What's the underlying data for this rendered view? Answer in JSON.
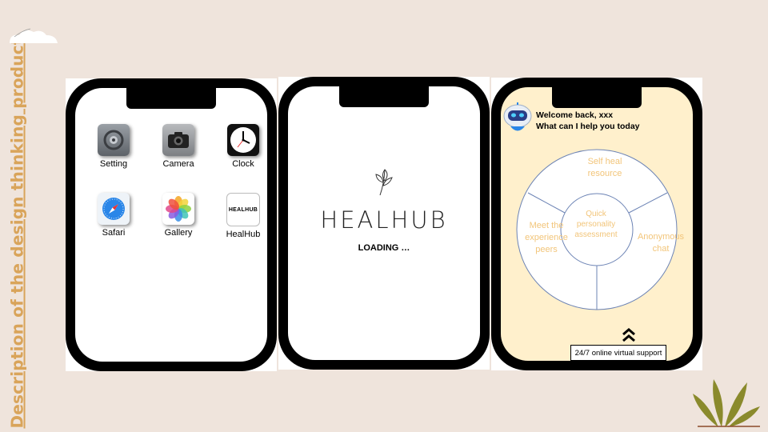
{
  "slide": {
    "side_title": "Description  of the design thinking product"
  },
  "phone1": {
    "apps": [
      {
        "label": "Setting",
        "icon": "settings-icon"
      },
      {
        "label": "Camera",
        "icon": "camera-icon"
      },
      {
        "label": "Clock",
        "icon": "clock-icon"
      },
      {
        "label": "Safari",
        "icon": "safari-compass-icon"
      },
      {
        "label": "Gallery",
        "icon": "gallery-photos-icon"
      },
      {
        "label": "HealHub",
        "icon": "healhub-app-icon",
        "icon_text": "HEALHUB"
      }
    ]
  },
  "phone2": {
    "brand": "HEALHUB",
    "loading": "LOADING …"
  },
  "phone3": {
    "welcome_line1": "Welcome back, xxx",
    "welcome_line2": "What can I help you today",
    "wheel": {
      "center": "Quick personality assessment",
      "top": "Self heal resource",
      "left": "Meet the experience peers",
      "right": "Anonymous chat"
    },
    "support": "24/7 online virtual support"
  },
  "colors": {
    "background": "#efe4dc",
    "accent": "#d9a45a",
    "wheel_text": "#f2c57a",
    "screen_yellow": "#fff0cc"
  }
}
